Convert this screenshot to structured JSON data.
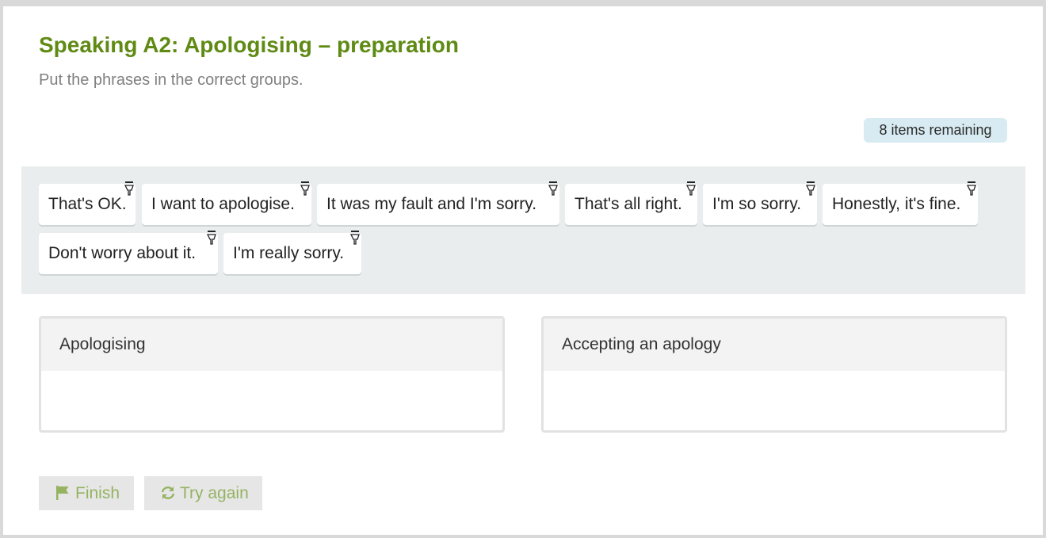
{
  "activity": {
    "title": "Speaking A2: Apologising – preparation",
    "instructions": "Put the phrases in the correct groups.",
    "remaining_label": "8 items remaining"
  },
  "items": [
    "That's OK.",
    "I want to apologise.",
    "It was my fault and I'm sorry.",
    "That's all right.",
    "I'm so sorry.",
    "Honestly, it's fine.",
    "Don't worry about it.",
    "I'm really sorry."
  ],
  "groups": [
    {
      "label": "Apologising"
    },
    {
      "label": "Accepting an apology"
    }
  ],
  "buttons": {
    "finish": "Finish",
    "try_again": "Try again"
  },
  "colors": {
    "title": "#5f8a14",
    "button_text": "#95b361",
    "remaining_badge": "#d8ebf2",
    "pool_background": "#e9edee"
  }
}
